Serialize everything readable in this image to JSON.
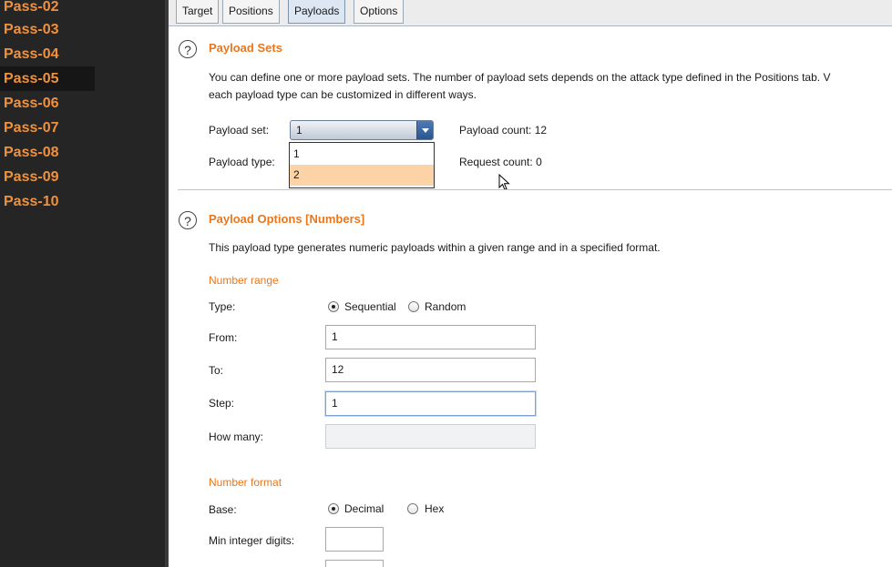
{
  "sidebar": {
    "items": [
      {
        "label": "Pass-02"
      },
      {
        "label": "Pass-03"
      },
      {
        "label": "Pass-04"
      },
      {
        "label": "Pass-05"
      },
      {
        "label": "Pass-06"
      },
      {
        "label": "Pass-07"
      },
      {
        "label": "Pass-08"
      },
      {
        "label": "Pass-09"
      },
      {
        "label": "Pass-10"
      }
    ],
    "selected": "Pass-05"
  },
  "tabs": [
    {
      "label": "Target"
    },
    {
      "label": "Positions"
    },
    {
      "label": "Payloads"
    },
    {
      "label": "Options"
    }
  ],
  "active_tab": "Payloads",
  "payload_sets": {
    "title": "Payload Sets",
    "description_line1": "You can define one or more payload sets. The number of payload sets depends on the attack type defined in the Positions tab. V",
    "description_line2": "each payload type can be customized in different ways.",
    "set_label": "Payload set:",
    "set_value": "1",
    "set_options": [
      "1",
      "2"
    ],
    "highlighted_option": "2",
    "type_label": "Payload type:",
    "count_label": "Payload count:",
    "count_value": "12",
    "request_label": "Request count:",
    "request_value": "0"
  },
  "payload_options": {
    "title": "Payload Options [Numbers]",
    "description": "This payload type generates numeric payloads within a given range and in a specified format.",
    "number_range_heading": "Number range",
    "type_label": "Type:",
    "type_options": [
      "Sequential",
      "Random"
    ],
    "type_selected": "Sequential",
    "from_label": "From:",
    "from_value": "1",
    "to_label": "To:",
    "to_value": "12",
    "step_label": "Step:",
    "step_value": "1",
    "how_many_label": "How many:",
    "how_many_value": "",
    "number_format_heading": "Number format",
    "base_label": "Base:",
    "base_options": [
      "Decimal",
      "Hex"
    ],
    "base_selected": "Decimal",
    "min_int_label": "Min integer digits:",
    "min_int_value": ""
  },
  "icons": {
    "help": "?"
  }
}
